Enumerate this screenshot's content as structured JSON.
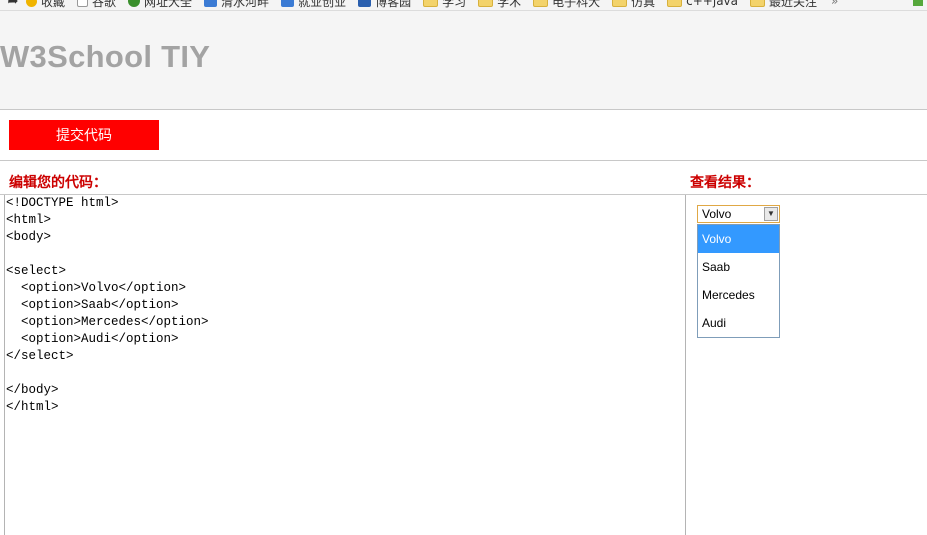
{
  "bookmarks": {
    "items": [
      {
        "label": "收藏",
        "icon": "star-icon"
      },
      {
        "label": "谷歌",
        "icon": "page-icon"
      },
      {
        "label": "网址大全",
        "icon": "globe-icon"
      },
      {
        "label": "清水河畔",
        "icon": "site-icon"
      },
      {
        "label": "就业创业",
        "icon": "site-icon"
      },
      {
        "label": "博客园",
        "icon": "blog-icon"
      },
      {
        "label": "学习",
        "icon": "folder-icon"
      },
      {
        "label": "学术",
        "icon": "folder-icon"
      },
      {
        "label": "电子科大",
        "icon": "folder-icon"
      },
      {
        "label": "仿真",
        "icon": "folder-icon"
      },
      {
        "label": "c++java",
        "icon": "folder-icon"
      },
      {
        "label": "最近关注",
        "icon": "folder-icon"
      }
    ],
    "more": "»"
  },
  "header": {
    "title": "W3School TIY"
  },
  "toolbar": {
    "submit_label": "提交代码"
  },
  "editor": {
    "label": "编辑您的代码：",
    "lines": [
      "<!DOCTYPE html>",
      "<html>",
      "<body>",
      "",
      "<select>",
      "  <option>Volvo</option>",
      "  <option>Saab</option>",
      "  <option>Mercedes</option>",
      "  <option>Audi</option>",
      "</select>",
      "",
      "</body>",
      "</html>"
    ]
  },
  "result": {
    "label": "查看结果：",
    "select": {
      "value": "Volvo",
      "options": [
        "Volvo",
        "Saab",
        "Mercedes",
        "Audi"
      ],
      "highlighted": "Volvo"
    }
  },
  "colors": {
    "accent_red": "#ff0000",
    "label_red": "#cc0000",
    "logo_gray": "#a3a3a3",
    "highlight_blue": "#3399ff"
  }
}
